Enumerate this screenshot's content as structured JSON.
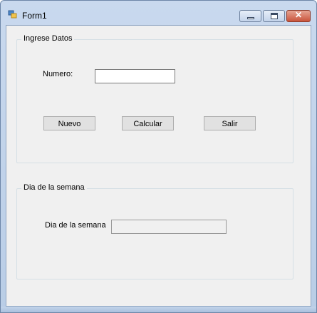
{
  "window": {
    "title": "Form1",
    "icon": "winforms-app-icon",
    "controls": [
      "minimize-icon",
      "maximize-icon",
      "close-icon"
    ]
  },
  "group_input": {
    "title": "Ingrese Datos",
    "numero_label": "Numero:",
    "numero_value": "",
    "buttons": {
      "nuevo": "Nuevo",
      "calcular": "Calcular",
      "salir": "Salir"
    }
  },
  "group_output": {
    "title": "Dia de la semana",
    "dia_label": "Dia de la semana",
    "dia_value": ""
  },
  "colors": {
    "client_bg": "#f0f0f0",
    "title_gradient_top": "#c9d9ee",
    "close_button": "#c9543b"
  }
}
